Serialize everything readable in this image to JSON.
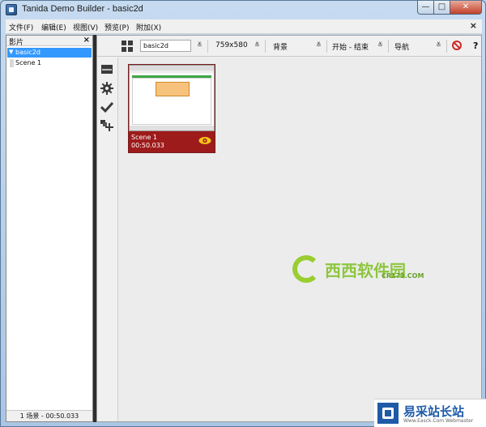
{
  "window": {
    "title": "Tanida Demo Builder - basic2d",
    "min_glyph": "—",
    "max_glyph": "□",
    "close_glyph": "✕"
  },
  "menubar": {
    "items": [
      "文件(F)",
      "编辑(E)",
      "视图(V)",
      "预览(P)",
      "附加(X)"
    ],
    "close_glyph": "×"
  },
  "left_panel": {
    "header": "影片",
    "close_glyph": "×",
    "tree": {
      "movie": "basic2d",
      "scene": "Scene 1"
    },
    "status": "1 场景 - 00:50.033"
  },
  "toolbar": {
    "movie_name": "basic2d",
    "resolution": "759x580",
    "background": "背景",
    "start_end": "开始 - 结束",
    "navigation": "导航",
    "help": "?"
  },
  "scene_card": {
    "name": "Scene 1",
    "duration": "00:50.033"
  },
  "watermarks": {
    "center_main": "西西软件园",
    "center_sub": "CR173.COM",
    "corner_main": "易采站长站",
    "corner_sub": "Www.Easck.Com Webmaster"
  },
  "icons": {
    "grid_view": "grid-view-icon",
    "scene_list": "screen-icon",
    "settings": "gear-icon",
    "checkmark": "check-icon",
    "add_scene": "add-scene-icon",
    "no_entry": "no-entry-icon",
    "eye": "eye-icon"
  },
  "colors": {
    "selection": "#3399ff",
    "scene_card": "#9e1b1b",
    "eye": "#f5c518",
    "watermark_green": "#8dc63f"
  }
}
